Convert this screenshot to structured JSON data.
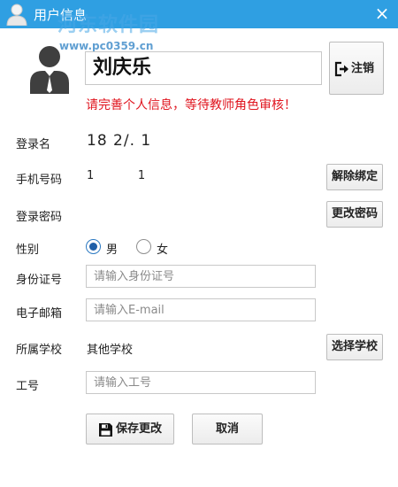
{
  "window": {
    "title": "用户信息",
    "close_symbol": "×"
  },
  "watermark": {
    "line1": "河东软件园",
    "line2": "www.pc0359.cn"
  },
  "profile": {
    "name": "刘庆乐",
    "logout_label": "注销",
    "notice": "请完善个人信息，等待教师角色审核！"
  },
  "fields": {
    "login_name": {
      "label": "登录名",
      "value": "18        2/. 1"
    },
    "phone": {
      "label": "手机号码",
      "value": "1            1",
      "button": "解除绑定"
    },
    "password": {
      "label": "登录密码",
      "button": "更改密码"
    },
    "gender": {
      "label": "性别",
      "options": [
        "男",
        "女"
      ],
      "selected": "男"
    },
    "id_number": {
      "label": "身份证号",
      "placeholder": "请输入身份证号",
      "value": ""
    },
    "email": {
      "label": "电子邮箱",
      "placeholder": "请输入E-mail",
      "value": ""
    },
    "school": {
      "label": "所属学校",
      "value": "其他学校",
      "button": "选择学校"
    },
    "staff_id": {
      "label": "工号",
      "placeholder": "请输入工号",
      "value": ""
    }
  },
  "actions": {
    "save_label": "保存更改",
    "cancel_label": "取消"
  },
  "colors": {
    "titlebar": "#2f9fe2",
    "notice": "#e0141e",
    "radio_selected": "#1f5fa8"
  }
}
